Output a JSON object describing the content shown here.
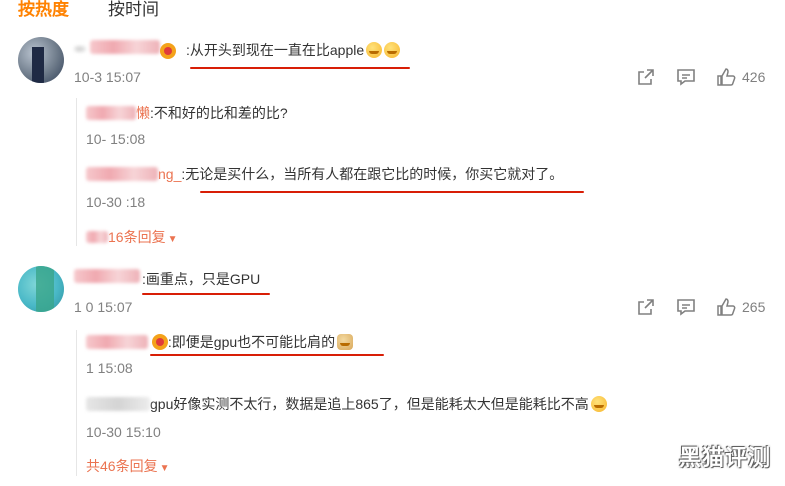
{
  "tabs": [
    {
      "label": "按热度",
      "active": true
    },
    {
      "label": "按时间",
      "active": false
    }
  ],
  "comments": [
    {
      "text": ":从开头到现在一直在比apple",
      "time": "10-3  15:07",
      "likes": "426",
      "replies": [
        {
          "name_suffix": "懒",
          "text": ":不和好的比和差的比?",
          "time": "10-  15:08"
        },
        {
          "name_suffix": "ng_",
          "text": ":无论是买什么，当所有人都在跟它比的时候，你买它就对了。",
          "time": "10-30  :18"
        }
      ],
      "more_replies": "16条回复"
    },
    {
      "text": ":画重点，只是GPU",
      "time": "1   0 15:07",
      "likes": "265",
      "replies": [
        {
          "text": ":即便是gpu也不可能比肩的",
          "time": "1   15:08"
        },
        {
          "text": "gpu好像实测不太行，数据是追上865了，但是能耗太大但是能耗比不高",
          "time": "10-30 15:10"
        }
      ],
      "more_replies": "共46条回复"
    }
  ],
  "watermark": "黑猫评测",
  "colors": {
    "accent": "#ff8200",
    "link": "#eb7350",
    "underline": "#d81e06",
    "meta": "#808080"
  }
}
